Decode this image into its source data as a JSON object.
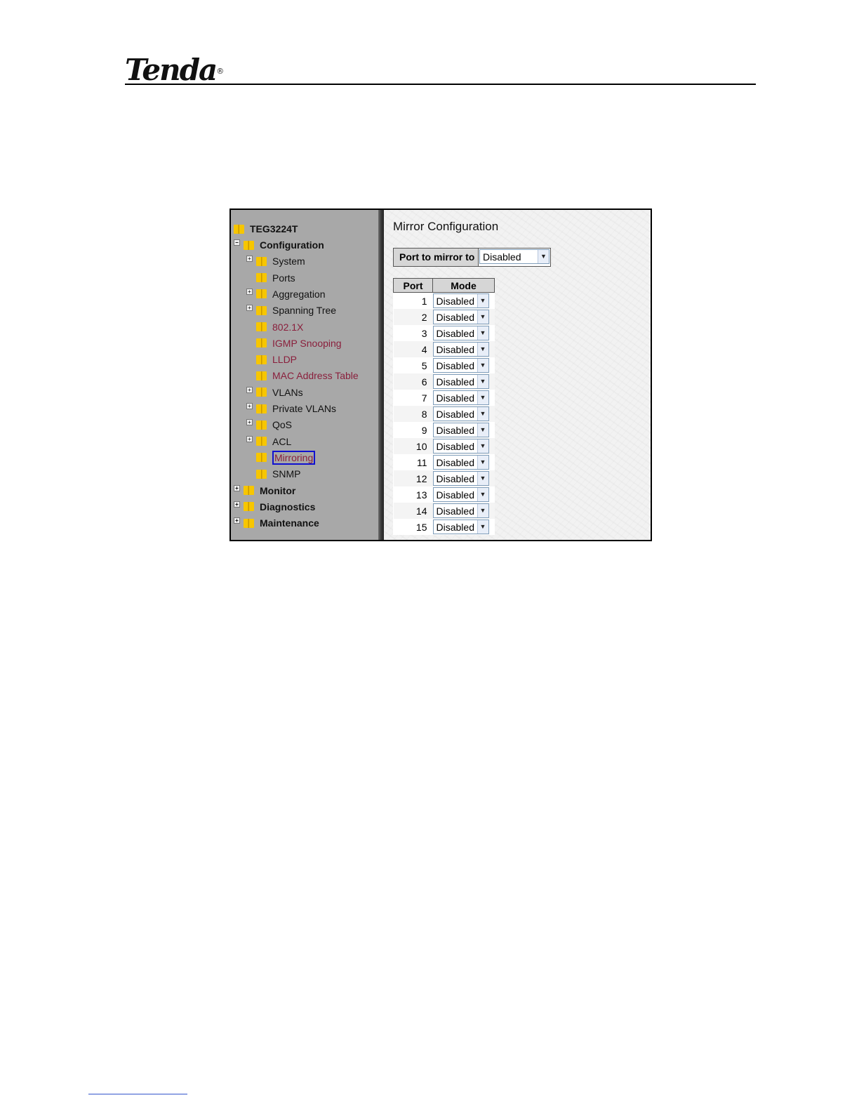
{
  "document": {
    "brand": "Tenda",
    "brand_mark": "®"
  },
  "sidebar": {
    "root": "TEG3224T",
    "items": [
      {
        "label": "Configuration",
        "expander": "−",
        "bold": true,
        "level": 1
      },
      {
        "label": "System",
        "expander": "+",
        "level": 2
      },
      {
        "label": "Ports",
        "expander": "",
        "level": 2
      },
      {
        "label": "Aggregation",
        "expander": "+",
        "level": 2
      },
      {
        "label": "Spanning Tree",
        "expander": "+",
        "level": 2
      },
      {
        "label": "802.1X",
        "expander": "",
        "level": 2,
        "maroon": true
      },
      {
        "label": "IGMP Snooping",
        "expander": "",
        "level": 2,
        "maroon": true
      },
      {
        "label": "LLDP",
        "expander": "",
        "level": 2,
        "maroon": true
      },
      {
        "label": "MAC Address Table",
        "expander": "",
        "level": 2,
        "maroon": true
      },
      {
        "label": "VLANs",
        "expander": "+",
        "level": 2
      },
      {
        "label": "Private VLANs",
        "expander": "+",
        "level": 2
      },
      {
        "label": "QoS",
        "expander": "+",
        "level": 2
      },
      {
        "label": "ACL",
        "expander": "+",
        "level": 2
      },
      {
        "label": "Mirroring",
        "expander": "",
        "level": 2,
        "selected": true
      },
      {
        "label": "SNMP",
        "expander": "",
        "level": 2
      },
      {
        "label": "Monitor",
        "expander": "+",
        "bold": true,
        "level": 1
      },
      {
        "label": "Diagnostics",
        "expander": "+",
        "bold": true,
        "level": 1
      },
      {
        "label": "Maintenance",
        "expander": "+",
        "bold": true,
        "level": 1
      }
    ]
  },
  "main": {
    "title": "Mirror Configuration",
    "port_to_mirror_label": "Port to mirror to",
    "port_to_mirror_value": "Disabled",
    "table": {
      "headers": [
        "Port",
        "Mode"
      ],
      "rows": [
        {
          "port": "1",
          "mode": "Disabled"
        },
        {
          "port": "2",
          "mode": "Disabled"
        },
        {
          "port": "3",
          "mode": "Disabled"
        },
        {
          "port": "4",
          "mode": "Disabled"
        },
        {
          "port": "5",
          "mode": "Disabled"
        },
        {
          "port": "6",
          "mode": "Disabled"
        },
        {
          "port": "7",
          "mode": "Disabled"
        },
        {
          "port": "8",
          "mode": "Disabled"
        },
        {
          "port": "9",
          "mode": "Disabled"
        },
        {
          "port": "10",
          "mode": "Disabled"
        },
        {
          "port": "11",
          "mode": "Disabled"
        },
        {
          "port": "12",
          "mode": "Disabled"
        },
        {
          "port": "13",
          "mode": "Disabled"
        },
        {
          "port": "14",
          "mode": "Disabled"
        },
        {
          "port": "15",
          "mode": "Disabled"
        }
      ]
    }
  },
  "colors": {
    "sidebar_bg": "#a8a8a8",
    "folder": "#f7c600",
    "maroon_link": "#8a1f3c",
    "selected_border": "#1010d0"
  }
}
